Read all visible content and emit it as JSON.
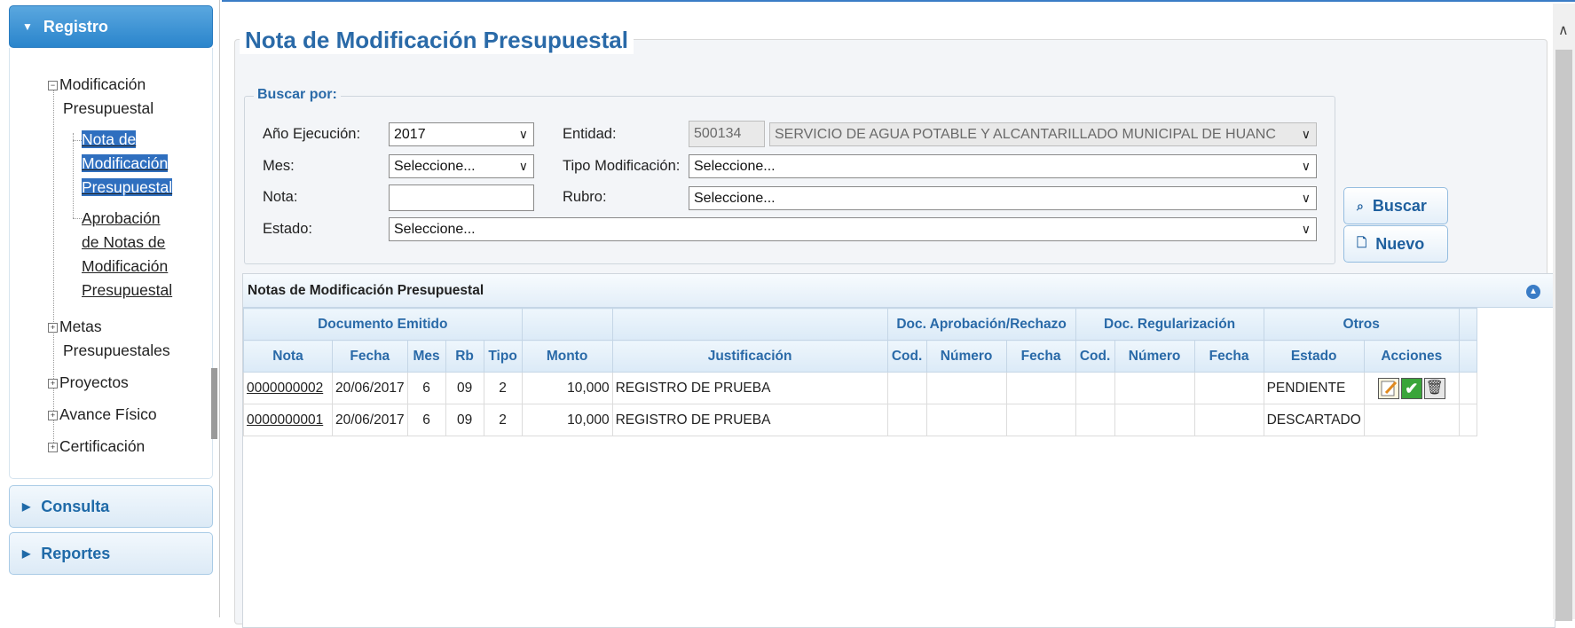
{
  "sidebar": {
    "registro_label": "Registro",
    "consulta_label": "Consulta",
    "reportes_label": "Reportes",
    "tree": {
      "modificacion": [
        "Modificación",
        "Presupuestal"
      ],
      "nota": [
        "Nota de",
        "Modificación",
        "Presupuestal"
      ],
      "aprobacion": [
        "Aprobación",
        "de Notas de",
        "Modificación",
        "Presupuestal"
      ],
      "metas": [
        "Metas",
        "Presupuestales"
      ],
      "proyectos": "Proyectos",
      "avance": "Avance Físico",
      "certificacion": "Certificación"
    }
  },
  "page": {
    "title": "Nota de Modificación Presupuestal"
  },
  "search": {
    "legend": "Buscar por:",
    "anio_label": "Año Ejecución:",
    "anio_value": "2017",
    "mes_label": "Mes:",
    "mes_value": "Seleccione...",
    "nota_label": "Nota:",
    "nota_value": "",
    "estado_label": "Estado:",
    "estado_value": "Seleccione...",
    "entidad_label": "Entidad:",
    "entidad_code": "500134",
    "entidad_name": "SERVICIO DE AGUA POTABLE Y ALCANTARILLADO MUNICIPAL DE HUANC",
    "tipo_label": "Tipo Modificación:",
    "tipo_value": "Seleccione...",
    "rubro_label": "Rubro:",
    "rubro_value": "Seleccione...",
    "buscar_button": "Buscar",
    "nuevo_button": "Nuevo"
  },
  "grid": {
    "caption": "Notas de Modificación Presupuestal",
    "group_headers": {
      "documento": "Documento Emitido",
      "aprobacion": "Doc. Aprobación/Rechazo",
      "regularizacion": "Doc. Regularización",
      "otros": "Otros"
    },
    "columns": [
      "Nota",
      "Fecha",
      "Mes",
      "Rb",
      "Tipo",
      "Monto",
      "Justificación",
      "Cod.",
      "Número",
      "Fecha",
      "Cod.",
      "Número",
      "Fecha",
      "Estado",
      "Acciones"
    ],
    "rows": [
      {
        "nota": "0000000002",
        "fecha": "20/06/2017",
        "mes": "6",
        "rb": "09",
        "tipo": "2",
        "monto": "10,000",
        "justificacion": "REGISTRO DE PRUEBA",
        "estado": "PENDIENTE"
      },
      {
        "nota": "0000000001",
        "fecha": "20/06/2017",
        "mes": "6",
        "rb": "09",
        "tipo": "2",
        "monto": "10,000",
        "justificacion": "REGISTRO DE PRUEBA",
        "estado": "DESCARTADO"
      }
    ]
  }
}
